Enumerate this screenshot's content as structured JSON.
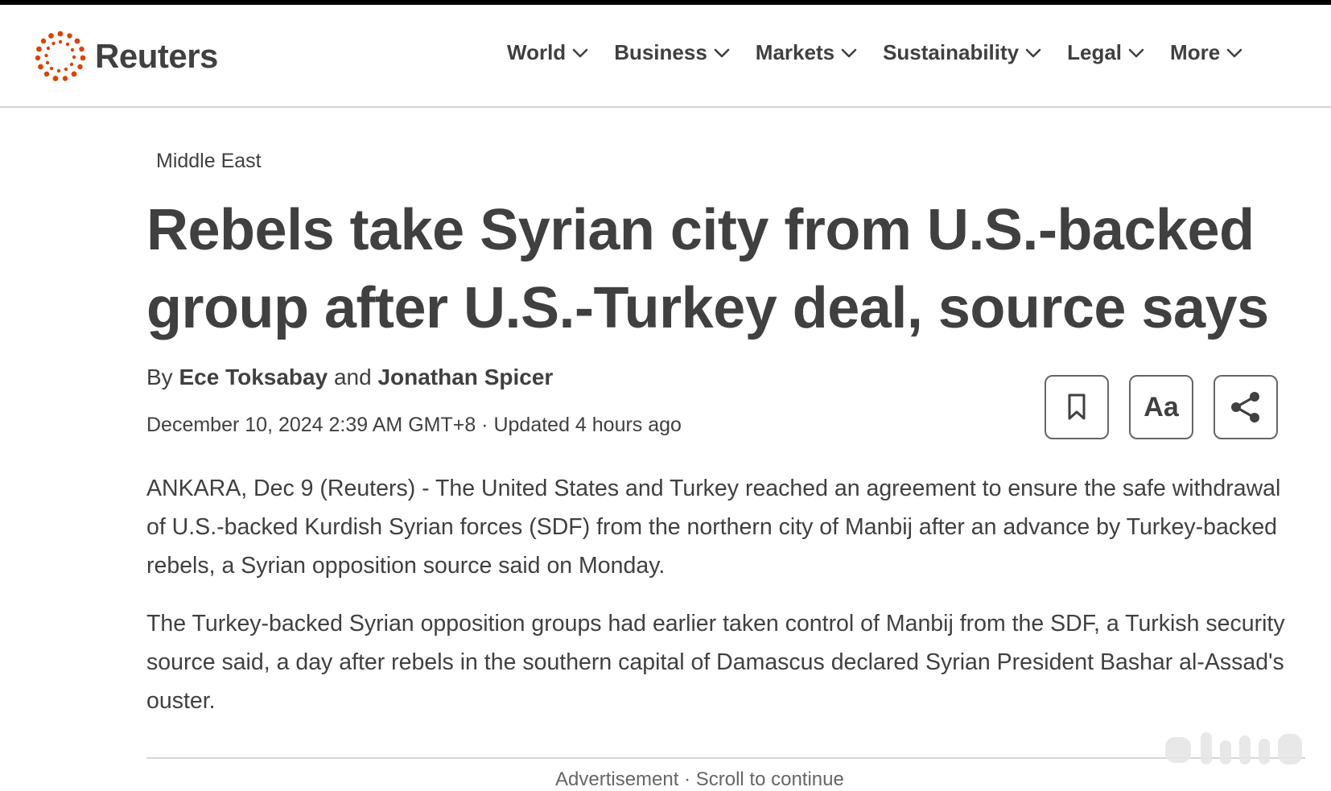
{
  "brand": {
    "name": "Reuters",
    "accent": "#dc4300"
  },
  "nav": {
    "items": [
      {
        "label": "World"
      },
      {
        "label": "Business"
      },
      {
        "label": "Markets"
      },
      {
        "label": "Sustainability"
      },
      {
        "label": "Legal"
      },
      {
        "label": "More"
      }
    ]
  },
  "article": {
    "section": "Middle East",
    "headline": "Rebels take Syrian city from U.S.-backed group after U.S.-Turkey deal, source says",
    "byline": {
      "prefix": "By",
      "author1": "Ece Toksabay",
      "conjunction": "and",
      "author2": "Jonathan Spicer"
    },
    "dateline": "December 10, 2024 2:39 AM GMT+8 · Updated 4 hours ago",
    "paragraphs": [
      "ANKARA, Dec 9 (Reuters) - The United States and Turkey reached an agreement to ensure the safe withdrawal of U.S.-backed Kurdish Syrian forces (SDF) from the northern city of Manbij after an advance by Turkey-backed rebels, a Syrian opposition source said on Monday.",
      "The Turkey-backed Syrian opposition groups had earlier taken control of Manbij from the SDF, a Turkish security source said, a day after rebels in the southern capital of Damascus declared Syrian President Bashar al-Assad's ouster."
    ],
    "ad_label": "Advertisement · Scroll to continue"
  },
  "tools": {
    "bookmark_icon": "bookmark-icon",
    "text_size_label": "Aa",
    "share_icon": "share-icon"
  }
}
